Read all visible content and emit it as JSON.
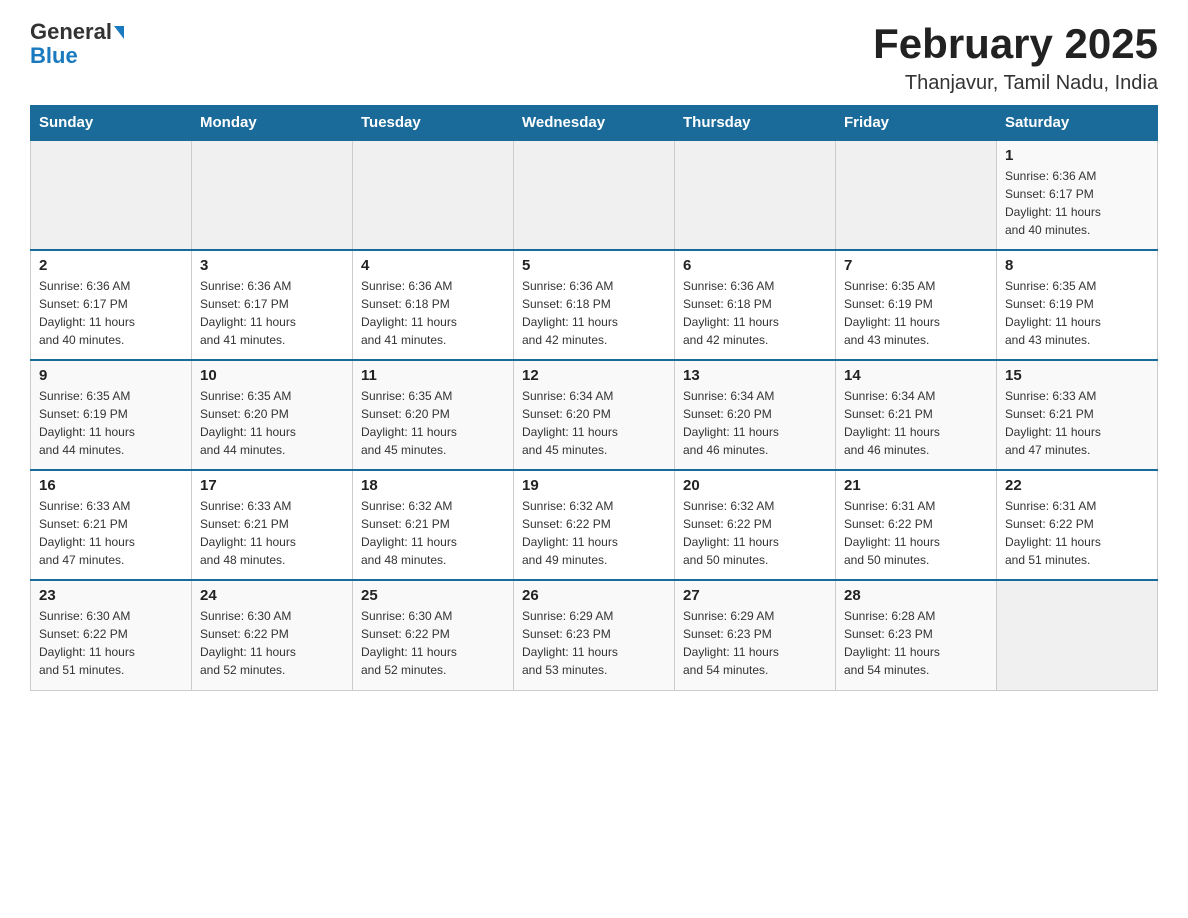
{
  "logo": {
    "general": "General",
    "blue": "Blue",
    "triangle": "▶"
  },
  "title": "February 2025",
  "subtitle": "Thanjavur, Tamil Nadu, India",
  "weekdays": [
    "Sunday",
    "Monday",
    "Tuesday",
    "Wednesday",
    "Thursday",
    "Friday",
    "Saturday"
  ],
  "weeks": [
    [
      {
        "day": "",
        "info": ""
      },
      {
        "day": "",
        "info": ""
      },
      {
        "day": "",
        "info": ""
      },
      {
        "day": "",
        "info": ""
      },
      {
        "day": "",
        "info": ""
      },
      {
        "day": "",
        "info": ""
      },
      {
        "day": "1",
        "info": "Sunrise: 6:36 AM\nSunset: 6:17 PM\nDaylight: 11 hours\nand 40 minutes."
      }
    ],
    [
      {
        "day": "2",
        "info": "Sunrise: 6:36 AM\nSunset: 6:17 PM\nDaylight: 11 hours\nand 40 minutes."
      },
      {
        "day": "3",
        "info": "Sunrise: 6:36 AM\nSunset: 6:17 PM\nDaylight: 11 hours\nand 41 minutes."
      },
      {
        "day": "4",
        "info": "Sunrise: 6:36 AM\nSunset: 6:18 PM\nDaylight: 11 hours\nand 41 minutes."
      },
      {
        "day": "5",
        "info": "Sunrise: 6:36 AM\nSunset: 6:18 PM\nDaylight: 11 hours\nand 42 minutes."
      },
      {
        "day": "6",
        "info": "Sunrise: 6:36 AM\nSunset: 6:18 PM\nDaylight: 11 hours\nand 42 minutes."
      },
      {
        "day": "7",
        "info": "Sunrise: 6:35 AM\nSunset: 6:19 PM\nDaylight: 11 hours\nand 43 minutes."
      },
      {
        "day": "8",
        "info": "Sunrise: 6:35 AM\nSunset: 6:19 PM\nDaylight: 11 hours\nand 43 minutes."
      }
    ],
    [
      {
        "day": "9",
        "info": "Sunrise: 6:35 AM\nSunset: 6:19 PM\nDaylight: 11 hours\nand 44 minutes."
      },
      {
        "day": "10",
        "info": "Sunrise: 6:35 AM\nSunset: 6:20 PM\nDaylight: 11 hours\nand 44 minutes."
      },
      {
        "day": "11",
        "info": "Sunrise: 6:35 AM\nSunset: 6:20 PM\nDaylight: 11 hours\nand 45 minutes."
      },
      {
        "day": "12",
        "info": "Sunrise: 6:34 AM\nSunset: 6:20 PM\nDaylight: 11 hours\nand 45 minutes."
      },
      {
        "day": "13",
        "info": "Sunrise: 6:34 AM\nSunset: 6:20 PM\nDaylight: 11 hours\nand 46 minutes."
      },
      {
        "day": "14",
        "info": "Sunrise: 6:34 AM\nSunset: 6:21 PM\nDaylight: 11 hours\nand 46 minutes."
      },
      {
        "day": "15",
        "info": "Sunrise: 6:33 AM\nSunset: 6:21 PM\nDaylight: 11 hours\nand 47 minutes."
      }
    ],
    [
      {
        "day": "16",
        "info": "Sunrise: 6:33 AM\nSunset: 6:21 PM\nDaylight: 11 hours\nand 47 minutes."
      },
      {
        "day": "17",
        "info": "Sunrise: 6:33 AM\nSunset: 6:21 PM\nDaylight: 11 hours\nand 48 minutes."
      },
      {
        "day": "18",
        "info": "Sunrise: 6:32 AM\nSunset: 6:21 PM\nDaylight: 11 hours\nand 48 minutes."
      },
      {
        "day": "19",
        "info": "Sunrise: 6:32 AM\nSunset: 6:22 PM\nDaylight: 11 hours\nand 49 minutes."
      },
      {
        "day": "20",
        "info": "Sunrise: 6:32 AM\nSunset: 6:22 PM\nDaylight: 11 hours\nand 50 minutes."
      },
      {
        "day": "21",
        "info": "Sunrise: 6:31 AM\nSunset: 6:22 PM\nDaylight: 11 hours\nand 50 minutes."
      },
      {
        "day": "22",
        "info": "Sunrise: 6:31 AM\nSunset: 6:22 PM\nDaylight: 11 hours\nand 51 minutes."
      }
    ],
    [
      {
        "day": "23",
        "info": "Sunrise: 6:30 AM\nSunset: 6:22 PM\nDaylight: 11 hours\nand 51 minutes."
      },
      {
        "day": "24",
        "info": "Sunrise: 6:30 AM\nSunset: 6:22 PM\nDaylight: 11 hours\nand 52 minutes."
      },
      {
        "day": "25",
        "info": "Sunrise: 6:30 AM\nSunset: 6:22 PM\nDaylight: 11 hours\nand 52 minutes."
      },
      {
        "day": "26",
        "info": "Sunrise: 6:29 AM\nSunset: 6:23 PM\nDaylight: 11 hours\nand 53 minutes."
      },
      {
        "day": "27",
        "info": "Sunrise: 6:29 AM\nSunset: 6:23 PM\nDaylight: 11 hours\nand 54 minutes."
      },
      {
        "day": "28",
        "info": "Sunrise: 6:28 AM\nSunset: 6:23 PM\nDaylight: 11 hours\nand 54 minutes."
      },
      {
        "day": "",
        "info": ""
      }
    ]
  ]
}
